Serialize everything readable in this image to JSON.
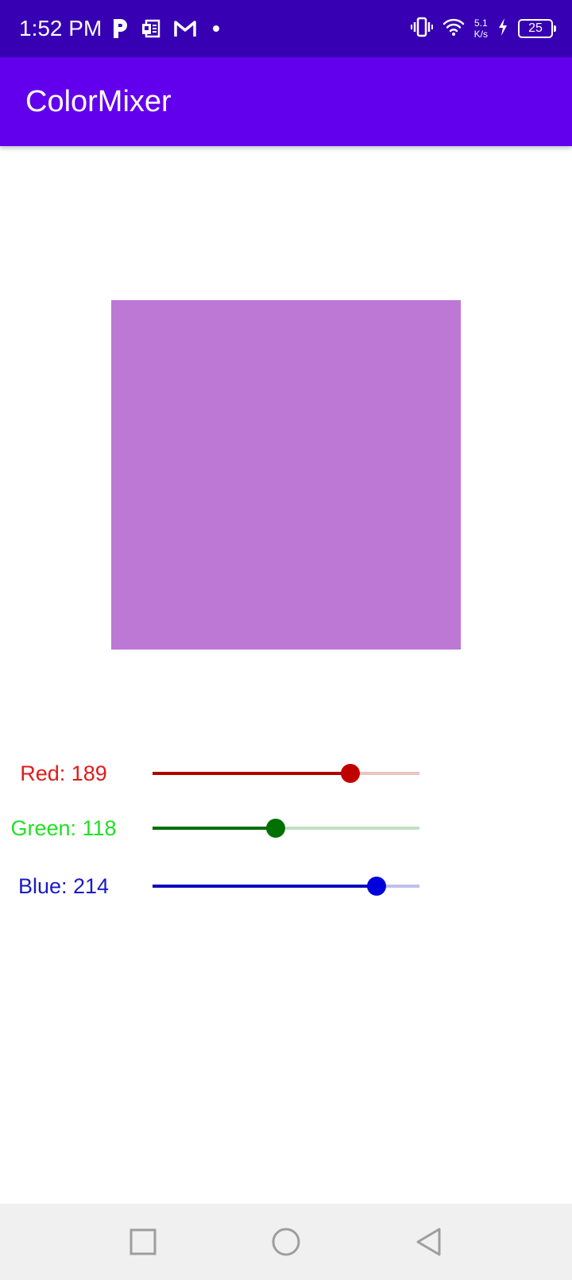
{
  "status_bar": {
    "time": "1:52 PM",
    "net_speed_value": "5.1",
    "net_speed_unit": "K/s",
    "battery_level": "25",
    "icons": [
      "paytm-icon",
      "ms-office-icon",
      "gmail-icon",
      "notification-dot-icon",
      "vibrate-icon",
      "wifi-icon",
      "charging-bolt-icon",
      "battery-icon"
    ]
  },
  "app_bar": {
    "title": "ColorMixer",
    "color": "#6200EE"
  },
  "preview": {
    "color": "#BD78D6"
  },
  "sliders": [
    {
      "name": "red",
      "label": "Red: 189",
      "value": 189,
      "max": 255,
      "text_color": "#E01B1B",
      "fill_color": "#B00000",
      "track_color": "#EBC3C3",
      "thumb_color": "#C00000"
    },
    {
      "name": "green",
      "label": "Green: 118",
      "value": 118,
      "max": 255,
      "text_color": "#22E022",
      "fill_color": "#006E00",
      "track_color": "#C2E0C2",
      "thumb_color": "#007000"
    },
    {
      "name": "blue",
      "label": "Blue: 214",
      "value": 214,
      "max": 255,
      "text_color": "#1A1AC8",
      "fill_color": "#0A0AC0",
      "track_color": "#BFC0EC",
      "thumb_color": "#0000DD"
    }
  ],
  "nav_bar": {
    "buttons": [
      "recents-square-icon",
      "home-circle-icon",
      "back-triangle-icon"
    ]
  }
}
